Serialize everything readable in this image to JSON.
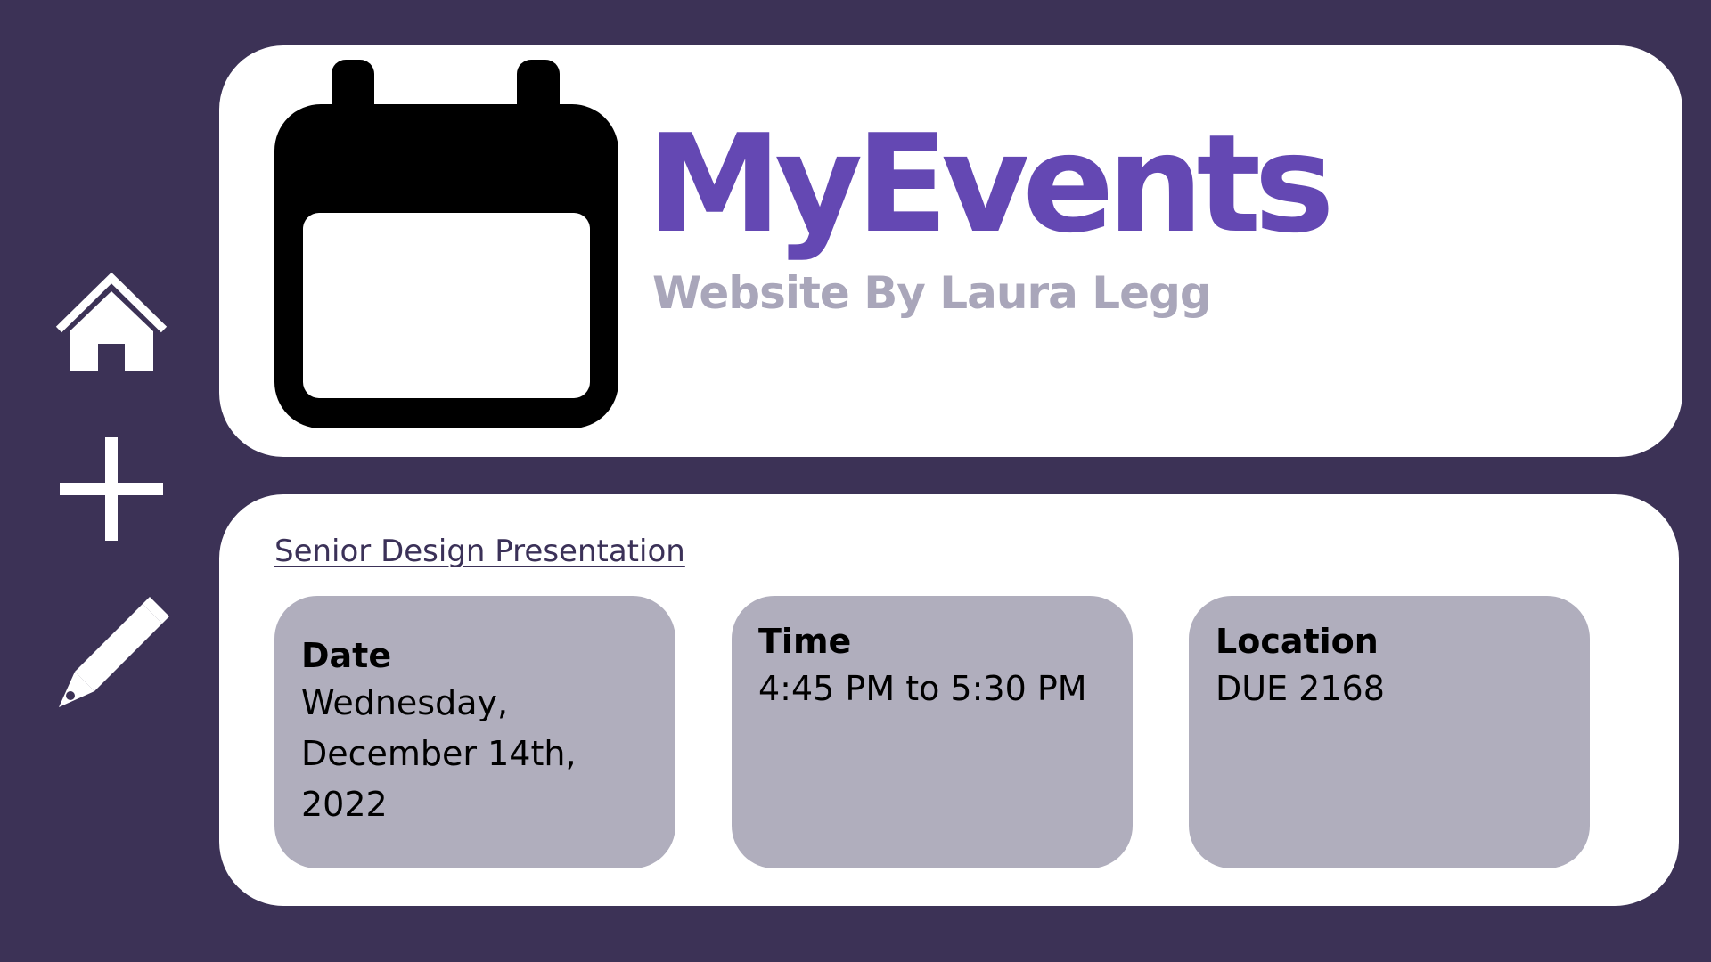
{
  "sidebar": {
    "items": [
      {
        "icon": "home-icon"
      },
      {
        "icon": "plus-icon"
      },
      {
        "icon": "pencil-icon"
      }
    ]
  },
  "header": {
    "logo_icon": "calendar-icon",
    "title": "MyEvents",
    "subtitle": "Website By Laura Legg"
  },
  "event": {
    "title": "Senior Design Presentation",
    "date": {
      "label": "Date",
      "value": "Wednesday, December 14th, 2022"
    },
    "time": {
      "label": "Time",
      "value": "4:45 PM to 5:30 PM"
    },
    "location": {
      "label": "Location",
      "value": "DUE 2168"
    }
  },
  "colors": {
    "background": "#3c3256",
    "accent": "#6448b3",
    "subtitle": "#a9a6ba",
    "card": "#ffffff",
    "info_box": "#b0aebd"
  }
}
